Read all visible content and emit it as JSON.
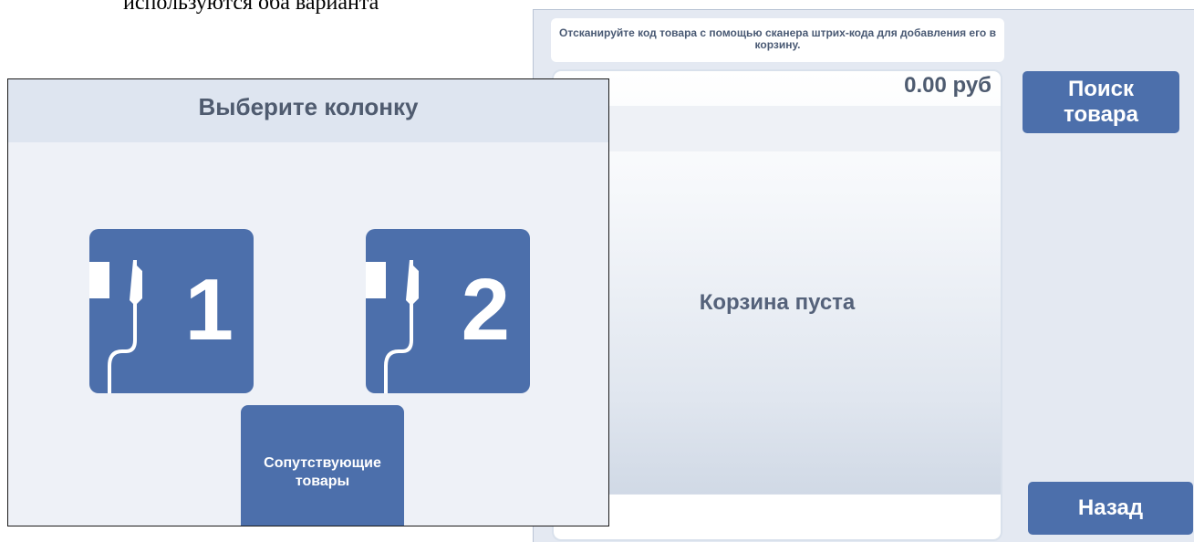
{
  "caption": "используются оба варианта",
  "cart": {
    "scan_hint": "Отсканируйте код товара с помощью сканера штрих-кода для добавления его в корзину.",
    "total": "0.00 руб",
    "empty_label": "Корзина пуста",
    "search_button": "Поиск товара",
    "back_button": "Назад"
  },
  "pump_select": {
    "title": "Выберите колонку",
    "pumps": [
      {
        "number": "1",
        "icon": "fuel-pump-icon"
      },
      {
        "number": "2",
        "icon": "fuel-pump-icon"
      }
    ],
    "related_goods_button": "Сопутствующие товары"
  },
  "colors": {
    "accent": "#4c6fab",
    "panel_bg": "#e4e9f2",
    "text_dark": "#4f5b6f"
  }
}
